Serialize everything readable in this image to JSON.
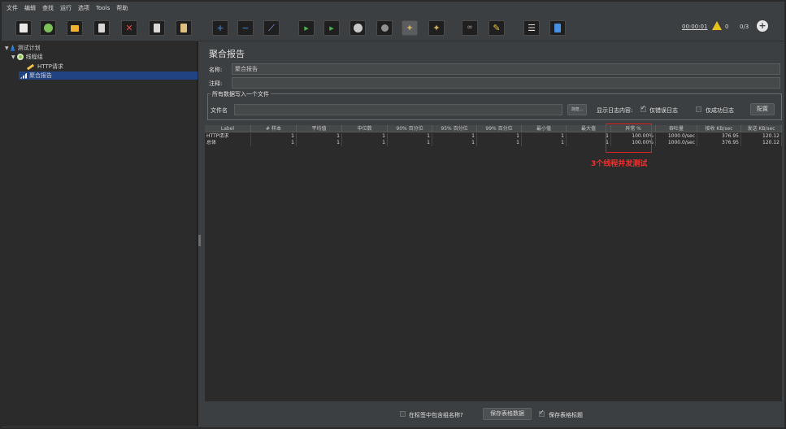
{
  "menubar": {
    "items": [
      "文件",
      "编辑",
      "查找",
      "运行",
      "选项",
      "Tools",
      "帮助"
    ]
  },
  "toolbar": {
    "timer": "00:00:01",
    "warning_count": "0",
    "thread_count": "0/3",
    "buttons": [
      {
        "icon": "new-icon",
        "color": "#e8e8e8"
      },
      {
        "icon": "templates-icon",
        "color": "#7dc05a"
      },
      {
        "icon": "open-icon",
        "color": "#f0b030"
      },
      {
        "icon": "save-icon",
        "color": "#d8d8d8"
      },
      {
        "icon": "cut-icon",
        "color": "#e84a4a"
      },
      {
        "icon": "copy-icon",
        "color": "#d8d8d8"
      },
      {
        "icon": "paste-icon",
        "color": "#e0c080"
      },
      {
        "icon": "expand-icon",
        "color": "#4a90e2"
      },
      {
        "icon": "collapse-icon",
        "color": "#4a90e2"
      },
      {
        "icon": "toggle-icon",
        "color": "#8ab4f8"
      },
      {
        "icon": "start-icon",
        "color": "#4caf50"
      },
      {
        "icon": "start-no-pause-icon",
        "color": "#4caf50"
      },
      {
        "icon": "stop-icon",
        "color": "#c8c8c8"
      },
      {
        "icon": "shutdown-icon",
        "color": "#909090"
      },
      {
        "icon": "clear-icon",
        "color": "#d0b060"
      },
      {
        "icon": "clear-all-icon",
        "color": "#d0b060"
      },
      {
        "icon": "search-icon",
        "color": "#a0a0a0"
      },
      {
        "icon": "reset-search-icon",
        "color": "#f0c040"
      },
      {
        "icon": "function-helper-icon",
        "color": "#e0e0e0"
      },
      {
        "icon": "help-icon",
        "color": "#4a90e2"
      }
    ]
  },
  "tree": {
    "test_plan": "测试计划",
    "thread_group": "线程组",
    "http_request": "HTTP请求",
    "aggregate_report": "聚合报告"
  },
  "panel": {
    "title": "聚合报告",
    "name_label": "名称:",
    "name_value": "聚合报告",
    "comment_label": "注释:",
    "comment_value": "",
    "file_group_title": "所有数据写入一个文件",
    "filename_label": "文件名",
    "filename_value": "",
    "browse_button": "浏览...",
    "log_content_label": "显示日志内容:",
    "errors_only_label": "仅错误日志",
    "errors_only_checked": true,
    "success_only_label": "仅成功日志",
    "success_only_checked": false,
    "configure_button": "配置"
  },
  "table": {
    "columns": [
      "Label",
      "# 样本",
      "平均值",
      "中位数",
      "90% 百分位",
      "95% 百分位",
      "99% 百分位",
      "最小值",
      "最大值",
      "异常 %",
      "吞吐量",
      "接收 KB/sec",
      "发送 KB/sec"
    ],
    "rows": [
      [
        "HTTP请求",
        "1",
        "1",
        "1",
        "1",
        "1",
        "1",
        "1",
        "1",
        "100.00%",
        "1000.0/sec",
        "376.95",
        "120.12"
      ],
      [
        "总体",
        "1",
        "1",
        "1",
        "1",
        "1",
        "1",
        "1",
        "1",
        "100.00%",
        "1000.0/sec",
        "376.95",
        "120.12"
      ]
    ]
  },
  "annotation": "3个线程并发测试",
  "bottombar": {
    "include_group_label": "在标签中包含组名称?",
    "include_group_checked": false,
    "save_table_button": "保存表格数据",
    "save_header_label": "保存表格标题",
    "save_header_checked": true
  }
}
